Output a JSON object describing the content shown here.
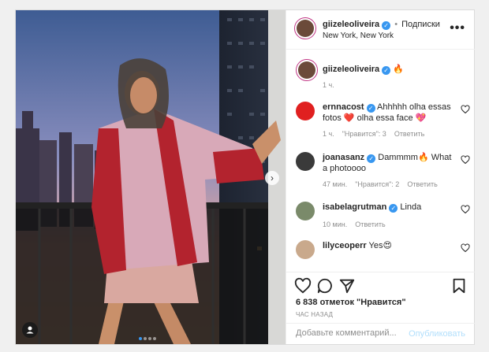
{
  "post": {
    "author": "giizeleoliveira",
    "follow_separator": "•",
    "follow_label": "Подписки",
    "location": "New York, New York",
    "more_label": "•••",
    "caption": {
      "username": "giizeleoliveira",
      "emoji": "🔥",
      "time": "1 ч."
    },
    "carousel": {
      "count": 4,
      "active_index": 0
    }
  },
  "comments": [
    {
      "username": "ernnacost",
      "verified": true,
      "text": "Ahhhhh olha essas fotos ❤️ olha essa face 💖",
      "time": "1 ч.",
      "likes": "\"Нравится\": 3",
      "reply": "Ответить",
      "avatar_color": "#e02020"
    },
    {
      "username": "joanasanz",
      "verified": true,
      "text": "Dammmm🔥 What a photoooo",
      "time": "47 мин.",
      "likes": "\"Нравится\": 2",
      "reply": "Ответить",
      "avatar_color": "#3a3a3a"
    },
    {
      "username": "isabelagrutman",
      "verified": true,
      "text": "Linda",
      "time": "10 мин.",
      "likes": "",
      "reply": "Ответить",
      "avatar_color": "#7a8a6a"
    },
    {
      "username": "lilyceoperr",
      "verified": false,
      "text": "Yes😍",
      "time": "",
      "likes": "",
      "reply": "",
      "avatar_color": "#c9a98c"
    }
  ],
  "actions": {
    "likes_count": "6 838 отметок \"Нравится\"",
    "time_ago": "ЧАС НАЗАД"
  },
  "add_comment": {
    "placeholder": "Добавьте комментарий...",
    "post_label": "Опубликовать"
  },
  "colors": {
    "verified": "#3897f0",
    "post_disabled": "#b2dffc",
    "border": "#dbdbdb"
  },
  "icons": [
    "heart-icon",
    "comment-icon",
    "share-icon",
    "bookmark-icon",
    "chevron-right-icon",
    "user-tag-icon",
    "more-icon"
  ]
}
